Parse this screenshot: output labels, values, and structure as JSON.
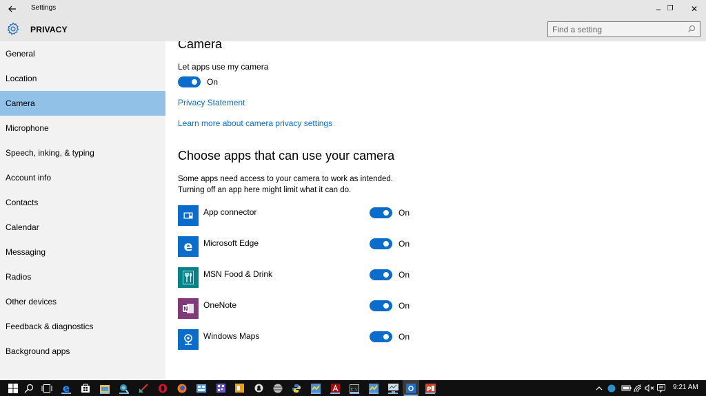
{
  "window": {
    "title": "Settings",
    "controls": {
      "minimize": "–",
      "restore": "❐",
      "close": "✕"
    }
  },
  "header": {
    "section": "PRIVACY",
    "search_placeholder": "Find a setting"
  },
  "sidebar": {
    "active": "Camera",
    "items": [
      {
        "label": "General"
      },
      {
        "label": "Location"
      },
      {
        "label": "Camera"
      },
      {
        "label": "Microphone"
      },
      {
        "label": "Speech, inking, & typing"
      },
      {
        "label": "Account info"
      },
      {
        "label": "Contacts"
      },
      {
        "label": "Calendar"
      },
      {
        "label": "Messaging"
      },
      {
        "label": "Radios"
      },
      {
        "label": "Other devices"
      },
      {
        "label": "Feedback & diagnostics"
      },
      {
        "label": "Background apps"
      }
    ]
  },
  "main": {
    "title": "Camera",
    "master_setting": {
      "label": "Let apps use my camera",
      "state": "On",
      "enabled": true
    },
    "links": {
      "privacy_statement": "Privacy Statement",
      "learn_more": "Learn more about camera privacy settings"
    },
    "apps_section": {
      "title": "Choose apps that can use your camera",
      "description_line1": "Some apps need access to your camera to work as intended.",
      "description_line2": "Turning off an app here might limit what it can do.",
      "apps": [
        {
          "name": "App connector",
          "state": "On",
          "enabled": true,
          "icon": "app-connector-icon",
          "color": "#0a6dcc"
        },
        {
          "name": "Microsoft Edge",
          "state": "On",
          "enabled": true,
          "icon": "edge-icon",
          "color": "#0a6dcc"
        },
        {
          "name": "MSN Food & Drink",
          "state": "On",
          "enabled": true,
          "icon": "food-drink-icon",
          "color": "#00828a"
        },
        {
          "name": "OneNote",
          "state": "On",
          "enabled": true,
          "icon": "onenote-icon",
          "color": "#80397b"
        },
        {
          "name": "Windows Maps",
          "state": "On",
          "enabled": true,
          "icon": "maps-icon",
          "color": "#0a6dcc"
        }
      ]
    }
  },
  "colors": {
    "accent": "#0a6dcc",
    "sidebar_active": "#91c1e7",
    "chrome": "#e6e6e6",
    "sidebar_bg": "#f2f2f2",
    "taskbar": "#101010"
  },
  "taskbar": {
    "clock": "9:21 AM",
    "pinned": [
      "start-icon",
      "search-icon",
      "task-view-icon",
      "edge-icon",
      "store-icon",
      "file-explorer-icon",
      "magnifier-app-icon",
      "pen-app-icon",
      "opera-icon",
      "firefox-icon",
      "remote-app-icon",
      "qr-app-icon",
      "office-icon",
      "app-icon",
      "globe-app-icon",
      "python-icon",
      "maps-app-icon",
      "acrobat-icon",
      "cmd-icon",
      "maps-app-2-icon",
      "monitor-app-icon",
      "settings-icon",
      "powerpoint-icon"
    ],
    "tray": [
      "show-hidden-icons",
      "network-globe-icon",
      "battery-icon",
      "wifi-icon",
      "volume-muted-icon",
      "action-center-icon"
    ]
  }
}
